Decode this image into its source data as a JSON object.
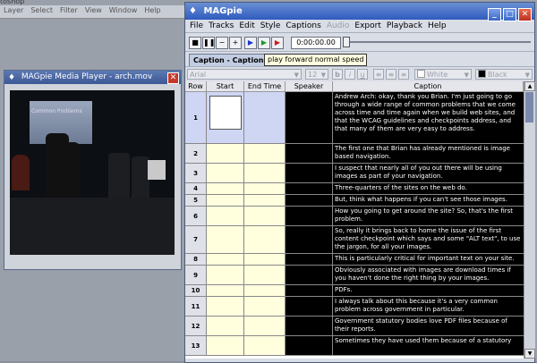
{
  "background_app": {
    "title_fragment": "toshop",
    "menu": [
      "Layer",
      "Select",
      "Filter",
      "View",
      "Window",
      "Help"
    ]
  },
  "player": {
    "title": "MAGpie Media Player - arch.mov",
    "video_text": "Common Problems",
    "close_glyph": "✕"
  },
  "main": {
    "title": "MAGpie",
    "menu": [
      {
        "label": "File",
        "enabled": true
      },
      {
        "label": "Tracks",
        "enabled": true
      },
      {
        "label": "Edit",
        "enabled": true
      },
      {
        "label": "Style",
        "enabled": true
      },
      {
        "label": "Captions",
        "enabled": true
      },
      {
        "label": "Audio",
        "enabled": false
      },
      {
        "label": "Export",
        "enabled": true
      },
      {
        "label": "Playback",
        "enabled": true
      },
      {
        "label": "Help",
        "enabled": true
      }
    ],
    "time_display": "0:00:00.00",
    "tab_label": "Caption - Captions",
    "tooltip": "play forward normal speed",
    "font_select": "Arial",
    "size_select": "12",
    "fore_color": "White",
    "back_color": "Black",
    "columns": [
      "Row",
      "Start Time",
      "End Time",
      "Speaker",
      "Caption"
    ],
    "rows": [
      {
        "n": "1",
        "h": 58,
        "caption": "Andrew Arch: okay, thank you Brian. I'm just going to go through a wide range of common problems that we come across time and time again when we build web sites, and that the WCAG guidelines and checkpoints address, and that many of them are very easy to address."
      },
      {
        "n": "2",
        "h": 22,
        "caption": "The first one that Brian has already mentioned is image based navigation."
      },
      {
        "n": "3",
        "h": 22,
        "caption": "I suspect that nearly all of you out there will be using images as part of your navigation."
      },
      {
        "n": "4",
        "h": 13,
        "caption": "Three-quarters of the sites on the web do."
      },
      {
        "n": "5",
        "h": 13,
        "caption": "But, think what happens if you can't see those images."
      },
      {
        "n": "6",
        "h": 22,
        "caption": "How you going to get around the site? So, that's the first problem."
      },
      {
        "n": "7",
        "h": 31,
        "caption": "So, really it brings back to home the issue of the first content checkpoint which says and some \"ALT text\", to use the jargon, for all your images."
      },
      {
        "n": "8",
        "h": 13,
        "caption": "This is particularly critical for important text on your site."
      },
      {
        "n": "9",
        "h": 22,
        "caption": "Obviously associated with images are download times if you haven't done the right thing by your images."
      },
      {
        "n": "10",
        "h": 13,
        "caption": "PDFs."
      },
      {
        "n": "11",
        "h": 22,
        "caption": "I always talk about this because it's a very common problem across government in particular."
      },
      {
        "n": "12",
        "h": 22,
        "caption": "Government statutory bodies love PDF files because of their reports."
      },
      {
        "n": "13",
        "h": 22,
        "caption": "Sometimes they have used them because of a statutory"
      }
    ]
  }
}
